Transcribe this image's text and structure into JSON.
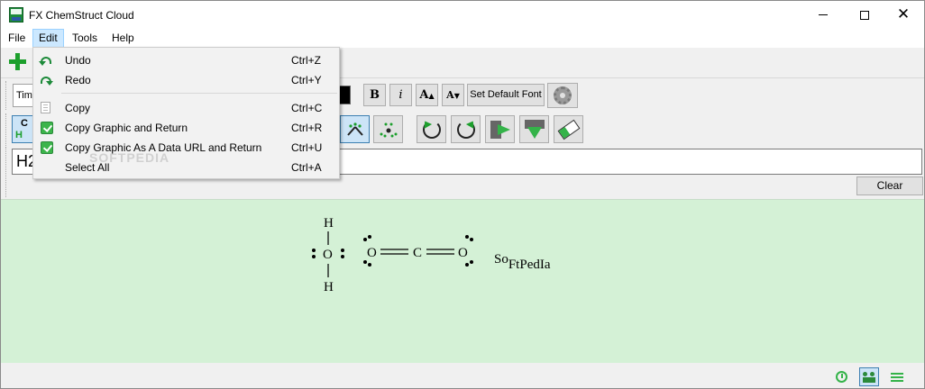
{
  "window": {
    "title": "FX ChemStruct Cloud",
    "minimize_glyph": "—",
    "maximize_glyph": "☐",
    "close_glyph": "✕"
  },
  "menubar": {
    "file": "File",
    "edit": "Edit",
    "tools": "Tools",
    "help": "Help"
  },
  "edit_menu": {
    "items": [
      {
        "label": "Undo",
        "shortcut": "Ctrl+Z",
        "icon": "undo-icon"
      },
      {
        "label": "Redo",
        "shortcut": "Ctrl+Y",
        "icon": "redo-icon"
      },
      {
        "label": "Copy",
        "shortcut": "Ctrl+C",
        "icon": "copy-icon"
      },
      {
        "label": "Copy Graphic and Return",
        "shortcut": "Ctrl+R",
        "icon": "check-icon"
      },
      {
        "label": "Copy Graphic As A Data URL and Return",
        "shortcut": "Ctrl+U",
        "icon": "check-icon"
      },
      {
        "label": "Select All",
        "shortcut": "Ctrl+A",
        "icon": ""
      }
    ]
  },
  "toolbar": {
    "font_name": "Time",
    "bold_label": "B",
    "italic_label": "i",
    "grow_label": "A",
    "shrink_label": "A",
    "default_font_label": "Set Default Font",
    "chem_c": "C",
    "chem_h": "H"
  },
  "formula": {
    "value": "H2"
  },
  "clear_label": "Clear",
  "molecules": {
    "water": {
      "top": "H",
      "center": "O",
      "bottom": "H"
    },
    "co2": {
      "left": "O",
      "center": "C",
      "right": "O"
    },
    "text_label": {
      "main": "So",
      "sub": "FtPedIa"
    }
  },
  "watermark": "SOFTPEDIA",
  "colors": {
    "canvas": "#d4f1d6",
    "accent_green": "#34b349",
    "menu_highlight": "#cce8ff"
  }
}
